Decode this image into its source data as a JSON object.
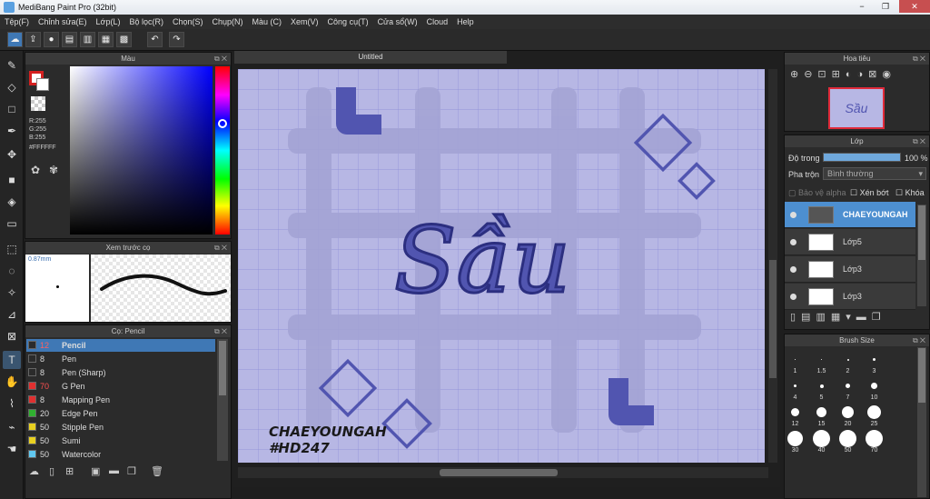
{
  "window": {
    "title": "MediBang Paint Pro (32bit)",
    "min": "−",
    "max": "❐",
    "close": "✕"
  },
  "menu": [
    "Tệp(F)",
    "Chỉnh sửa(E)",
    "Lớp(L)",
    "Bộ lọc(R)",
    "Chọn(S)",
    "Chụp(N)",
    "Màu (C)",
    "Xem(V)",
    "Công cụ(T)",
    "Cửa sổ(W)",
    "Cloud",
    "Help"
  ],
  "color_panel": {
    "title": "Màu",
    "r": "R:255",
    "g": "G:255",
    "b": "B:255",
    "hex": "#FFFFFF"
  },
  "preview_panel": {
    "title": "Xem trước cọ",
    "size": "0.87mm"
  },
  "brush_panel": {
    "title": "Cọ: Pencil",
    "items": [
      {
        "n": "12",
        "label": "Pencil",
        "color": "#2b2b2b"
      },
      {
        "n": "8",
        "label": "Pen",
        "color": "#2b2b2b"
      },
      {
        "n": "8",
        "label": "Pen (Sharp)",
        "color": "#2b2b2b"
      },
      {
        "n": "70",
        "label": "G Pen",
        "color": "#e03030"
      },
      {
        "n": "8",
        "label": "Mapping Pen",
        "color": "#e03030"
      },
      {
        "n": "20",
        "label": "Edge Pen",
        "color": "#30b030"
      },
      {
        "n": "50",
        "label": "Stipple Pen",
        "color": "#e8d020"
      },
      {
        "n": "50",
        "label": "Sumi",
        "color": "#e8d020"
      },
      {
        "n": "50",
        "label": "Watercolor",
        "color": "#60c8f0"
      }
    ]
  },
  "canvas": {
    "tab": "Untitled",
    "art_title": "Sầu",
    "signature_line1": "CHAEYOUNGAH",
    "signature_line2": "#HD247",
    "accent": "#5155b0",
    "bg": "#b7b7e4"
  },
  "navigator": {
    "title": "Hoa tiêu"
  },
  "layers_panel": {
    "title": "Lớp",
    "opacity_label": "Độ trong",
    "opacity_value": "100 %",
    "blend_label": "Pha trộn",
    "blend_value": "Bình thường",
    "protect_alpha": "Bảo vệ alpha",
    "clip": "Xén bớt",
    "lock": "Khóa",
    "layers": [
      {
        "name": "CHAEYOUNGAH",
        "selected": true
      },
      {
        "name": "Lớp5",
        "selected": false
      },
      {
        "name": "Lớp3",
        "selected": false
      },
      {
        "name": "Lớp3",
        "selected": false
      }
    ]
  },
  "brush_size_panel": {
    "title": "Brush Size",
    "sizes": [
      "1",
      "1.5",
      "2",
      "3",
      "4",
      "5",
      "7",
      "10",
      "12",
      "15",
      "20",
      "25",
      "30",
      "40",
      "50",
      "70"
    ]
  }
}
